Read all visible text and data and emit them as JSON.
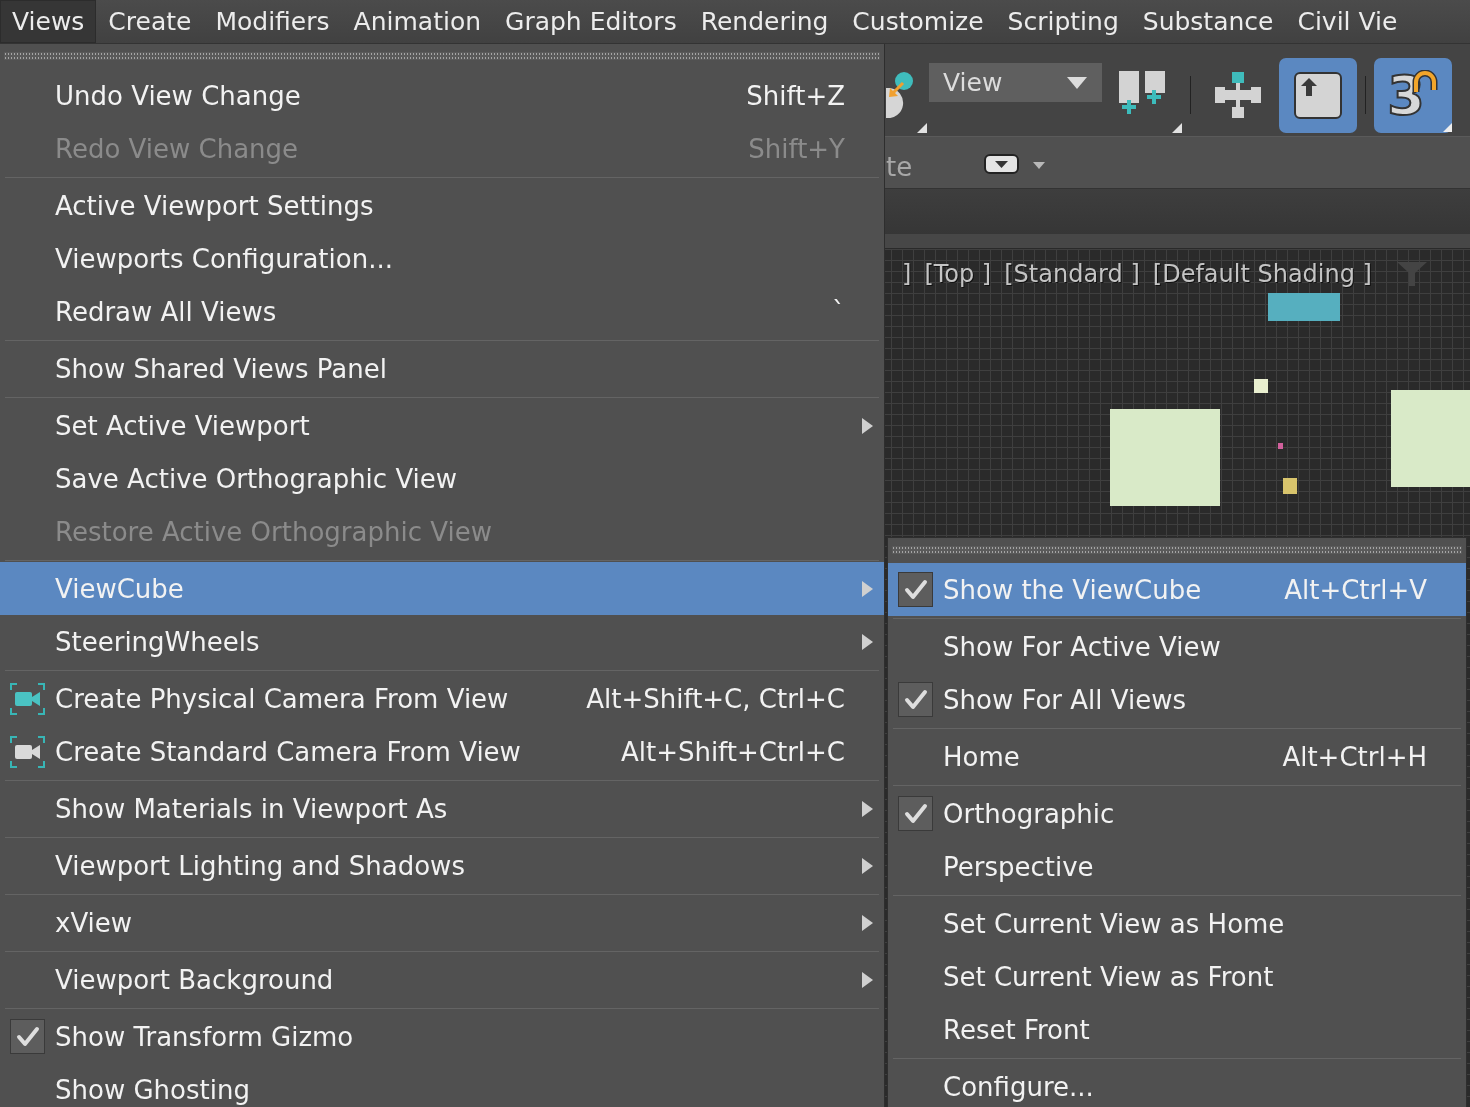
{
  "menu_bar": [
    {
      "label": "Views",
      "selected": true
    },
    {
      "label": "Create",
      "selected": false
    },
    {
      "label": "Modifiers",
      "selected": false
    },
    {
      "label": "Animation",
      "selected": false
    },
    {
      "label": "Graph Editors",
      "selected": false
    },
    {
      "label": "Rendering",
      "selected": false
    },
    {
      "label": "Customize",
      "selected": false
    },
    {
      "label": "Scripting",
      "selected": false
    },
    {
      "label": "Substance",
      "selected": false
    },
    {
      "label": "Civil Vie",
      "selected": false
    }
  ],
  "toolbar": {
    "view_dropdown": {
      "value": "View"
    },
    "toggles": [
      {
        "kind": "arrow-tile",
        "on": true
      },
      {
        "kind": "snap",
        "label": "3",
        "on": true
      }
    ]
  },
  "ribbon": {
    "text": "te"
  },
  "viewport": {
    "labels": [
      "]",
      "[Top ]",
      "[Standard ]",
      "[Default Shading ]"
    ]
  },
  "views_menu": {
    "groups": [
      [
        {
          "label": "Undo View Change",
          "shortcut": "Shift+Z",
          "kind": "item",
          "submenu": false,
          "disabled": false,
          "checked": false,
          "selected": false
        },
        {
          "label": "Redo View Change",
          "shortcut": "Shift+Y",
          "kind": "item",
          "submenu": false,
          "disabled": true,
          "checked": false,
          "selected": false
        }
      ],
      [
        {
          "label": "Active Viewport Settings",
          "kind": "item",
          "submenu": false,
          "disabled": false,
          "checked": false,
          "selected": false
        },
        {
          "label": "Viewports Configuration...",
          "kind": "item",
          "submenu": false,
          "disabled": false,
          "checked": false,
          "selected": false
        },
        {
          "label": "Redraw All Views",
          "shortcut": "`",
          "kind": "item",
          "submenu": false,
          "disabled": false,
          "checked": false,
          "selected": false
        }
      ],
      [
        {
          "label": "Show Shared Views Panel",
          "kind": "item",
          "submenu": false,
          "disabled": false,
          "checked": false,
          "selected": false
        }
      ],
      [
        {
          "label": "Set Active Viewport",
          "kind": "item",
          "submenu": true,
          "disabled": false,
          "checked": false,
          "selected": false
        },
        {
          "label": "Save Active Orthographic View",
          "kind": "item",
          "submenu": false,
          "disabled": false,
          "checked": false,
          "selected": false
        },
        {
          "label": "Restore Active Orthographic View",
          "kind": "item",
          "submenu": false,
          "disabled": true,
          "checked": false,
          "selected": false
        }
      ],
      [
        {
          "label": "ViewCube",
          "kind": "item",
          "submenu": true,
          "disabled": false,
          "checked": false,
          "selected": true
        },
        {
          "label": "SteeringWheels",
          "kind": "item",
          "submenu": true,
          "disabled": false,
          "checked": false,
          "selected": false
        }
      ],
      [
        {
          "label": "Create Physical Camera From View",
          "shortcut": "Alt+Shift+C, Ctrl+C",
          "kind": "physical-camera",
          "submenu": false,
          "disabled": false,
          "checked": false,
          "selected": false
        },
        {
          "label": "Create Standard Camera From View",
          "shortcut": "Alt+Shift+Ctrl+C",
          "kind": "standard-camera",
          "submenu": false,
          "disabled": false,
          "checked": false,
          "selected": false
        }
      ],
      [
        {
          "label": "Show Materials in Viewport As",
          "kind": "item",
          "submenu": true,
          "disabled": false,
          "checked": false,
          "selected": false
        }
      ],
      [
        {
          "label": "Viewport Lighting and Shadows",
          "kind": "item",
          "submenu": true,
          "disabled": false,
          "checked": false,
          "selected": false
        }
      ],
      [
        {
          "label": "xView",
          "kind": "item",
          "submenu": true,
          "disabled": false,
          "checked": false,
          "selected": false
        }
      ],
      [
        {
          "label": "Viewport Background",
          "kind": "item",
          "submenu": true,
          "disabled": false,
          "checked": false,
          "selected": false
        }
      ],
      [
        {
          "label": "Show Transform Gizmo",
          "kind": "item",
          "submenu": false,
          "disabled": false,
          "checked": true,
          "selected": false
        },
        {
          "label": "Show Ghosting",
          "kind": "item",
          "submenu": false,
          "disabled": false,
          "checked": false,
          "selected": false
        }
      ]
    ]
  },
  "viewcube_submenu": {
    "groups": [
      [
        {
          "label": "Show the ViewCube",
          "shortcut": "Alt+Ctrl+V",
          "submenu": false,
          "disabled": false,
          "checked": true,
          "selected": true
        }
      ],
      [
        {
          "label": "Show For Active View",
          "submenu": false,
          "disabled": false,
          "checked": false,
          "selected": false
        },
        {
          "label": "Show For All Views",
          "submenu": false,
          "disabled": false,
          "checked": true,
          "selected": false
        }
      ],
      [
        {
          "label": "Home",
          "shortcut": "Alt+Ctrl+H",
          "submenu": false,
          "disabled": false,
          "checked": false,
          "selected": false
        }
      ],
      [
        {
          "label": "Orthographic",
          "submenu": false,
          "disabled": false,
          "checked": true,
          "selected": false
        },
        {
          "label": "Perspective",
          "submenu": false,
          "disabled": false,
          "checked": false,
          "selected": false
        }
      ],
      [
        {
          "label": "Set Current View as Home",
          "submenu": false,
          "disabled": false,
          "checked": false,
          "selected": false
        },
        {
          "label": "Set Current View as Front",
          "submenu": false,
          "disabled": false,
          "checked": false,
          "selected": false
        },
        {
          "label": "Reset Front",
          "submenu": false,
          "disabled": false,
          "checked": false,
          "selected": false
        }
      ],
      [
        {
          "label": "Configure...",
          "submenu": false,
          "disabled": false,
          "checked": false,
          "selected": false
        }
      ]
    ]
  }
}
